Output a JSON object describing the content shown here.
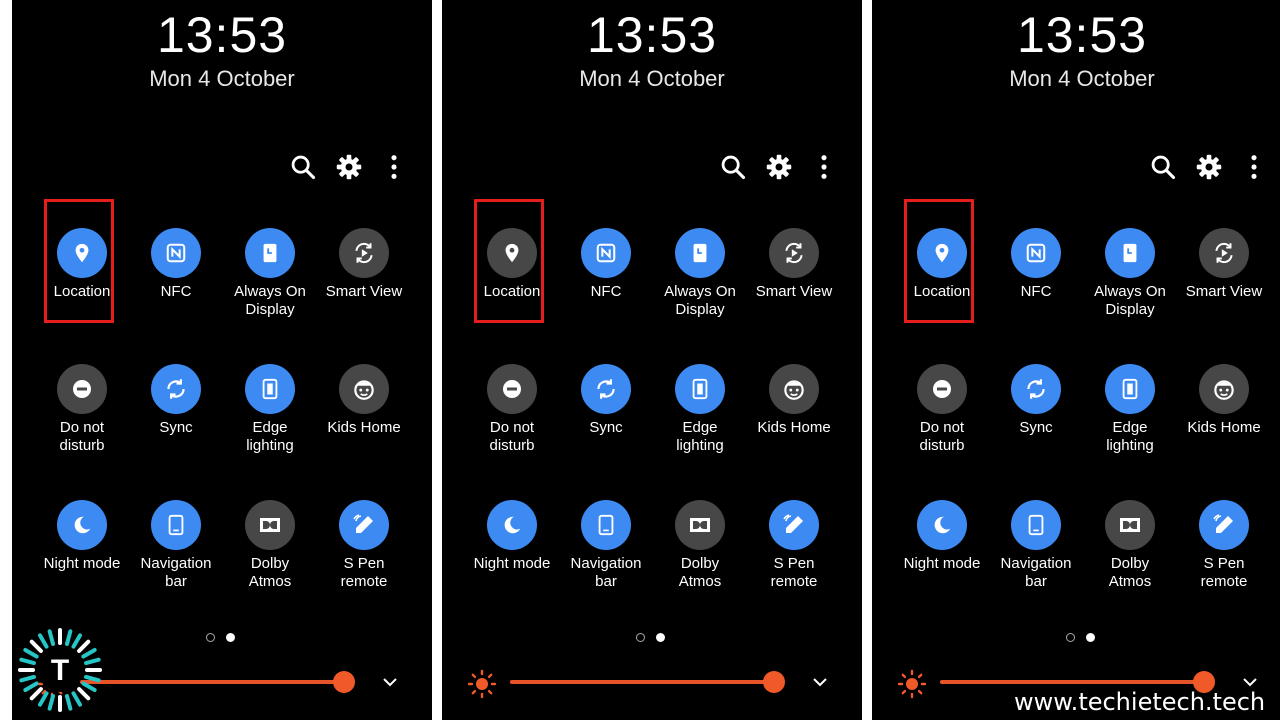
{
  "colors": {
    "tile_on": "#3d8bf2",
    "tile_off": "#474747",
    "highlight": "#e41d1d",
    "brightness": "#e8542a"
  },
  "panels": [
    {
      "time": "13:53",
      "date": "Mon 4 October",
      "location_state": "on",
      "tiles": {
        "location": "Location",
        "nfc": "NFC",
        "aod_1": "Always On",
        "aod_2": "Display",
        "smart_view": "Smart View",
        "dnd_1": "Do not",
        "dnd_2": "disturb",
        "sync": "Sync",
        "edge_1": "Edge",
        "edge_2": "lighting",
        "kids_home": "Kids Home",
        "night_mode": "Night mode",
        "nav_1": "Navigation",
        "nav_2": "bar",
        "dolby_1": "Dolby",
        "dolby_2": "Atmos",
        "spen_1": "S Pen",
        "spen_2": "remote"
      }
    },
    {
      "time": "13:53",
      "date": "Mon 4 October",
      "location_state": "off",
      "tiles": {
        "location": "Location",
        "nfc": "NFC",
        "aod_1": "Always On",
        "aod_2": "Display",
        "smart_view": "Smart View",
        "dnd_1": "Do not",
        "dnd_2": "disturb",
        "sync": "Sync",
        "edge_1": "Edge",
        "edge_2": "lighting",
        "kids_home": "Kids Home",
        "night_mode": "Night mode",
        "nav_1": "Navigation",
        "nav_2": "bar",
        "dolby_1": "Dolby",
        "dolby_2": "Atmos",
        "spen_1": "S Pen",
        "spen_2": "remote"
      }
    },
    {
      "time": "13:53",
      "date": "Mon 4 October",
      "location_state": "on",
      "tiles": {
        "location": "Location",
        "nfc": "NFC",
        "aod_1": "Always On",
        "aod_2": "Display",
        "smart_view": "Smart View",
        "dnd_1": "Do not",
        "dnd_2": "disturb",
        "sync": "Sync",
        "edge_1": "Edge",
        "edge_2": "lighting",
        "kids_home": "Kids Home",
        "night_mode": "Night mode",
        "nav_1": "Navigation",
        "nav_2": "bar",
        "dolby_1": "Dolby",
        "dolby_2": "Atmos",
        "spen_1": "S Pen",
        "spen_2": "remote"
      }
    }
  ],
  "icons": [
    "search-icon",
    "gear-icon",
    "more-vert-icon",
    "location-icon",
    "nfc-icon",
    "always-on-display-icon",
    "smart-view-icon",
    "do-not-disturb-icon",
    "sync-icon",
    "edge-lighting-icon",
    "kids-home-icon",
    "night-mode-icon",
    "navigation-bar-icon",
    "dolby-atmos-icon",
    "s-pen-icon",
    "brightness-icon",
    "chevron-down-icon"
  ],
  "page_indicator": {
    "current": 2,
    "total": 2
  },
  "logo_letter": "T",
  "watermark": "www.techietech.tech"
}
